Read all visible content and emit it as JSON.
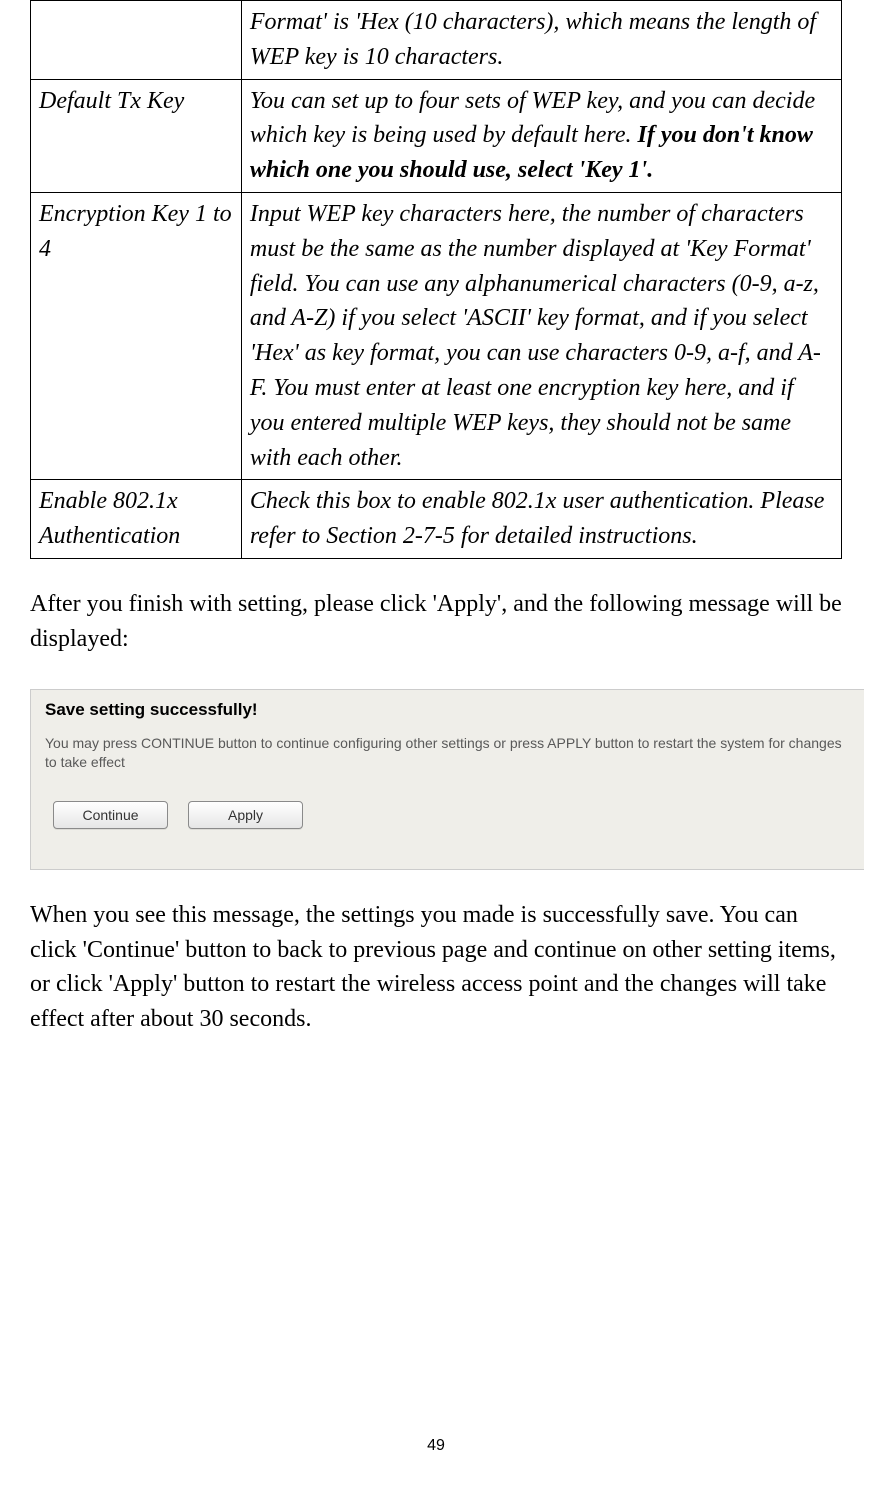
{
  "table": {
    "rows": [
      {
        "label": "",
        "desc_plain": "Format' is 'Hex (10 characters), which means the length of WEP key is 10 characters.",
        "desc_bold": ""
      },
      {
        "label": "Default Tx Key",
        "desc_plain": "You can set up to four sets of WEP key, and you can decide which key is being used by default here. ",
        "desc_bold": "If you don't know which one you should use, select 'Key 1'."
      },
      {
        "label": "Encryption Key 1 to 4",
        "desc_plain": "Input WEP key characters here, the number of characters must be the same as the number displayed at 'Key Format' field. You can use any alphanumerical characters (0-9, a-z, and A-Z) if you select 'ASCII' key format, and if you select 'Hex' as key format, you can use characters 0-9, a-f, and A-F. You must enter at least one encryption key here, and if you entered multiple WEP keys, they should not be same with each other.",
        "desc_bold": ""
      },
      {
        "label": "Enable 802.1x Authentication",
        "desc_plain": "Check this box to enable 802.1x user authentication. Please refer to Section 2-7-5 for detailed instructions.",
        "desc_bold": ""
      }
    ]
  },
  "para1": "After you finish with setting, please click 'Apply', and the following message will be displayed:",
  "dialog": {
    "title": "Save setting successfully!",
    "message": "You may press CONTINUE button to continue configuring other settings or press APPLY button to restart the system for changes to take effect",
    "btn_continue": "Continue",
    "btn_apply": "Apply"
  },
  "para2": "When you see this message, the settings you made is successfully save. You can click 'Continue' button to back to previous page and continue on other setting items, or click 'Apply' button to restart the wireless access point and the changes will take effect after about 30 seconds.",
  "page_number": "49"
}
